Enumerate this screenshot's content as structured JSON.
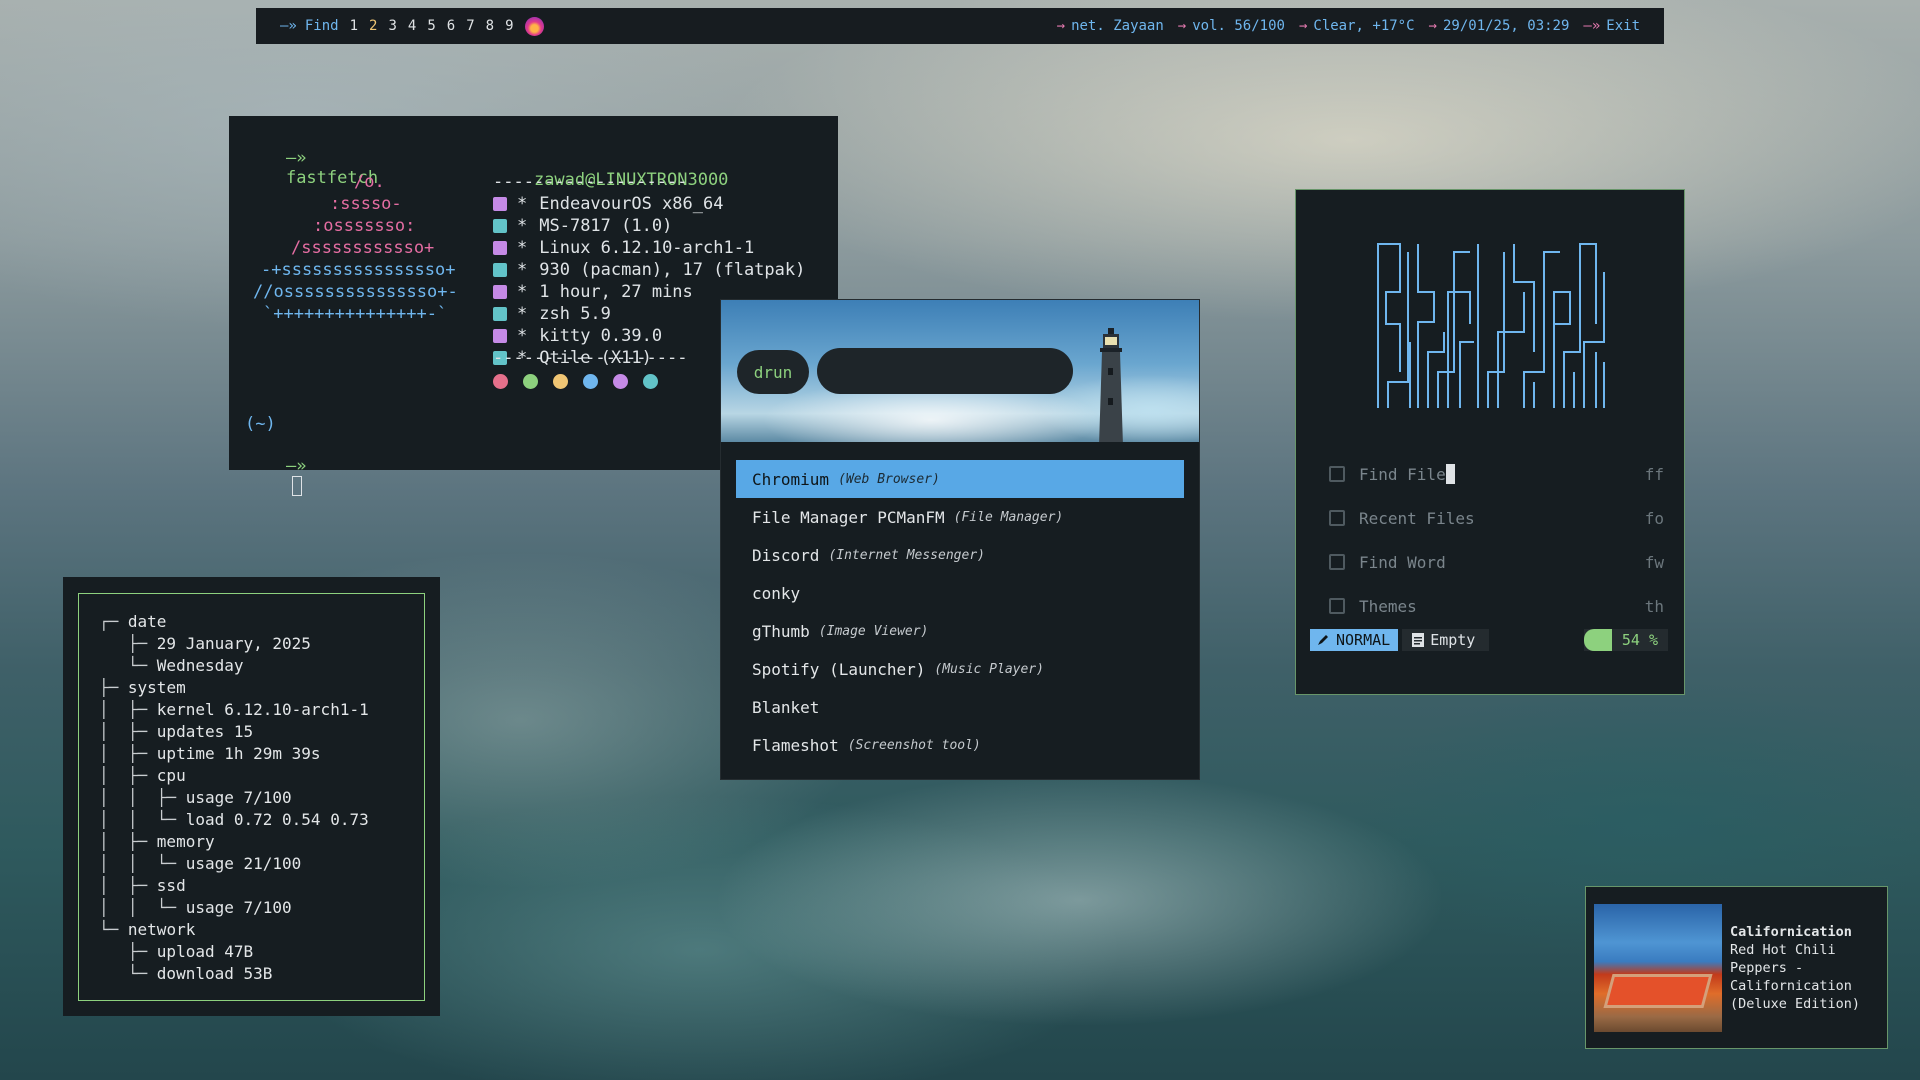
{
  "bar": {
    "find_label": "Find",
    "workspaces": [
      "1",
      "2",
      "3",
      "4",
      "5",
      "6",
      "7",
      "8",
      "9"
    ],
    "active_workspace": "2",
    "net": "net. Zayaan",
    "vol": "vol. 56/100",
    "weather": "Clear, +17°C",
    "datetime": "29/01/25, 03:29",
    "exit": "Exit",
    "colors": {
      "accent": "#6fb6ee",
      "arrow": "#e57ab0",
      "active_ws": "#f0c674"
    }
  },
  "fastfetch": {
    "command": "fastfetch",
    "prompt_arrow": "—»",
    "user_host": "zawad@LINUXTRON3000",
    "separator": "-------------------",
    "logo_lines": [
      "/o.",
      ":sssso-",
      ":osssssso:",
      "/ssssssssssso+",
      "-+ssssssssssssssso+",
      "//osssssssssssssso+-",
      "`+++++++++++++++-`"
    ],
    "info": [
      {
        "icon": "distro-icon",
        "text": "EndeavourOS x86_64"
      },
      {
        "icon": "host-icon",
        "text": "MS-7817 (1.0)"
      },
      {
        "icon": "kernel-icon",
        "text": "Linux 6.12.10-arch1-1"
      },
      {
        "icon": "package-icon",
        "text": "930 (pacman), 17 (flatpak)"
      },
      {
        "icon": "hourglass-icon",
        "text": "1 hour, 27 mins"
      },
      {
        "icon": "shell-icon",
        "text": "zsh 5.9"
      },
      {
        "icon": "terminal-icon",
        "text": "kitty 0.39.0"
      },
      {
        "icon": "window-manager-icon",
        "text": "Qtile (X11)"
      }
    ],
    "bullet": "*",
    "color_dots": [
      "#e5708b",
      "#8dd17e",
      "#f0c674",
      "#6fb6ee",
      "#c58ae6",
      "#62c3c8"
    ],
    "cwd": "(~)"
  },
  "launcher": {
    "mode": "drun",
    "query": "",
    "items": [
      {
        "name": "Chromium",
        "desc": "(Web Browser)",
        "selected": true
      },
      {
        "name": "File Manager PCManFM",
        "desc": "(File Manager)"
      },
      {
        "name": "Discord",
        "desc": "(Internet Messenger)"
      },
      {
        "name": "conky",
        "desc": ""
      },
      {
        "name": "gThumb",
        "desc": "(Image Viewer)"
      },
      {
        "name": "Spotify (Launcher)",
        "desc": "(Music Player)"
      },
      {
        "name": "Blanket",
        "desc": ""
      },
      {
        "name": "Flameshot",
        "desc": "(Screenshot tool)"
      }
    ]
  },
  "tree": {
    "rows": [
      {
        "prefix": "┌─ ",
        "text": "date"
      },
      {
        "prefix": "   ├─ ",
        "text": "29 January, 2025"
      },
      {
        "prefix": "   └─ ",
        "text": "Wednesday"
      },
      {
        "prefix": "├─ ",
        "text": "system"
      },
      {
        "prefix": "│  ├─ ",
        "text": "kernel 6.12.10-arch1-1"
      },
      {
        "prefix": "│  ├─ ",
        "text": "updates 15"
      },
      {
        "prefix": "│  ├─ ",
        "text": "uptime 1h 29m 39s"
      },
      {
        "prefix": "│  ├─ ",
        "text": "cpu"
      },
      {
        "prefix": "│  │  ├─ ",
        "text": "usage 7/100"
      },
      {
        "prefix": "│  │  └─ ",
        "text": "load 0.72 0.54 0.73"
      },
      {
        "prefix": "│  ├─ ",
        "text": "memory"
      },
      {
        "prefix": "│  │  └─ ",
        "text": "usage 21/100"
      },
      {
        "prefix": "│  ├─ ",
        "text": "ssd"
      },
      {
        "prefix": "│  │  └─ ",
        "text": "usage 7/100"
      },
      {
        "prefix": "└─ ",
        "text": "network"
      },
      {
        "prefix": "   ├─ ",
        "text": "upload 47B"
      },
      {
        "prefix": "   └─ ",
        "text": "download 53B"
      }
    ]
  },
  "nvim": {
    "menu": [
      {
        "icon": "file-search-icon",
        "label": "Find File",
        "key": "ff"
      },
      {
        "icon": "history-icon",
        "label": "Recent Files",
        "key": "fo"
      },
      {
        "icon": "word-icon",
        "label": "Find Word",
        "key": "fw"
      },
      {
        "icon": "brush-icon",
        "label": "Themes",
        "key": "th"
      }
    ],
    "mode": "NORMAL",
    "buffer": "Empty",
    "percent": "54 %"
  },
  "music": {
    "title": "Californication",
    "artist_album": "Red Hot Chili Peppers - Californication (Deluxe Edition)"
  }
}
